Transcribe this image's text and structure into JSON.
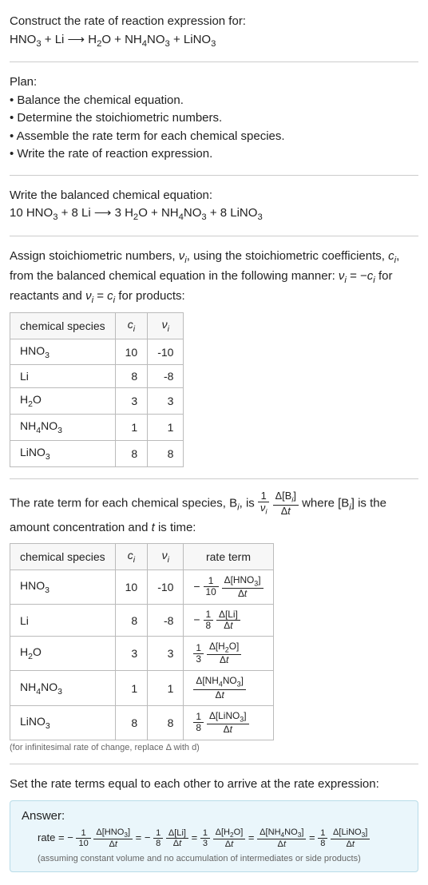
{
  "header": {
    "title": "Construct the rate of reaction expression for:",
    "equation": "HNO₃ + Li ⟶ H₂O + NH₄NO₃ + LiNO₃"
  },
  "plan": {
    "title": "Plan:",
    "items": [
      "• Balance the chemical equation.",
      "• Determine the stoichiometric numbers.",
      "• Assemble the rate term for each chemical species.",
      "• Write the rate of reaction expression."
    ]
  },
  "balanced": {
    "title": "Write the balanced chemical equation:",
    "equation": "10 HNO₃ + 8 Li ⟶ 3 H₂O + NH₄NO₃ + 8 LiNO₃"
  },
  "stoich": {
    "intro_before": "Assign stoichiometric numbers, ",
    "intro_after1": ", using the stoichiometric coefficients, ",
    "intro_after2": ", from the balanced chemical equation in the following manner: ",
    "intro_after3": " for reactants and ",
    "intro_after4": " for products:",
    "table_headers": [
      "chemical species",
      "cᵢ",
      "νᵢ"
    ],
    "rows": [
      {
        "species": "HNO₃",
        "c": "10",
        "nu": "-10"
      },
      {
        "species": "Li",
        "c": "8",
        "nu": "-8"
      },
      {
        "species": "H₂O",
        "c": "3",
        "nu": "3"
      },
      {
        "species": "NH₄NO₃",
        "c": "1",
        "nu": "1"
      },
      {
        "species": "LiNO₃",
        "c": "8",
        "nu": "8"
      }
    ]
  },
  "rate_term": {
    "intro_before": "The rate term for each chemical species, B",
    "intro_after1": ", is ",
    "intro_after2": " where [B",
    "intro_after3": "] is the amount concentration and ",
    "intro_after4": " is time:",
    "table_headers": [
      "chemical species",
      "cᵢ",
      "νᵢ",
      "rate term"
    ],
    "rows": [
      {
        "species": "HNO₃",
        "c": "10",
        "nu": "-10",
        "sign": "−",
        "frac_n": "1",
        "frac_d": "10",
        "delta": "Δ[HNO₃]"
      },
      {
        "species": "Li",
        "c": "8",
        "nu": "-8",
        "sign": "−",
        "frac_n": "1",
        "frac_d": "8",
        "delta": "Δ[Li]"
      },
      {
        "species": "H₂O",
        "c": "3",
        "nu": "3",
        "sign": "",
        "frac_n": "1",
        "frac_d": "3",
        "delta": "Δ[H₂O]"
      },
      {
        "species": "NH₄NO₃",
        "c": "1",
        "nu": "1",
        "sign": "",
        "frac_n": "",
        "frac_d": "",
        "delta": "Δ[NH₄NO₃]"
      },
      {
        "species": "LiNO₃",
        "c": "8",
        "nu": "8",
        "sign": "",
        "frac_n": "1",
        "frac_d": "8",
        "delta": "Δ[LiNO₃]"
      }
    ],
    "note": "(for infinitesimal rate of change, replace Δ with d)"
  },
  "final": {
    "title": "Set the rate terms equal to each other to arrive at the rate expression:",
    "answer_label": "Answer:",
    "rate_prefix": "rate = ",
    "note": "(assuming constant volume and no accumulation of intermediates or side products)"
  },
  "chart_data": {
    "type": "table",
    "tables": [
      {
        "title": "stoichiometric numbers",
        "columns": [
          "chemical species",
          "c_i",
          "nu_i"
        ],
        "rows": [
          [
            "HNO3",
            10,
            -10
          ],
          [
            "Li",
            8,
            -8
          ],
          [
            "H2O",
            3,
            3
          ],
          [
            "NH4NO3",
            1,
            1
          ],
          [
            "LiNO3",
            8,
            8
          ]
        ]
      },
      {
        "title": "rate terms",
        "columns": [
          "chemical species",
          "c_i",
          "nu_i",
          "rate term"
        ],
        "rows": [
          [
            "HNO3",
            10,
            -10,
            "-(1/10) Δ[HNO3]/Δt"
          ],
          [
            "Li",
            8,
            -8,
            "-(1/8) Δ[Li]/Δt"
          ],
          [
            "H2O",
            3,
            3,
            "(1/3) Δ[H2O]/Δt"
          ],
          [
            "NH4NO3",
            1,
            1,
            "Δ[NH4NO3]/Δt"
          ],
          [
            "LiNO3",
            8,
            8,
            "(1/8) Δ[LiNO3]/Δt"
          ]
        ]
      }
    ],
    "rate_expression": "rate = -(1/10) Δ[HNO3]/Δt = -(1/8) Δ[Li]/Δt = (1/3) Δ[H2O]/Δt = Δ[NH4NO3]/Δt = (1/8) Δ[LiNO3]/Δt"
  }
}
